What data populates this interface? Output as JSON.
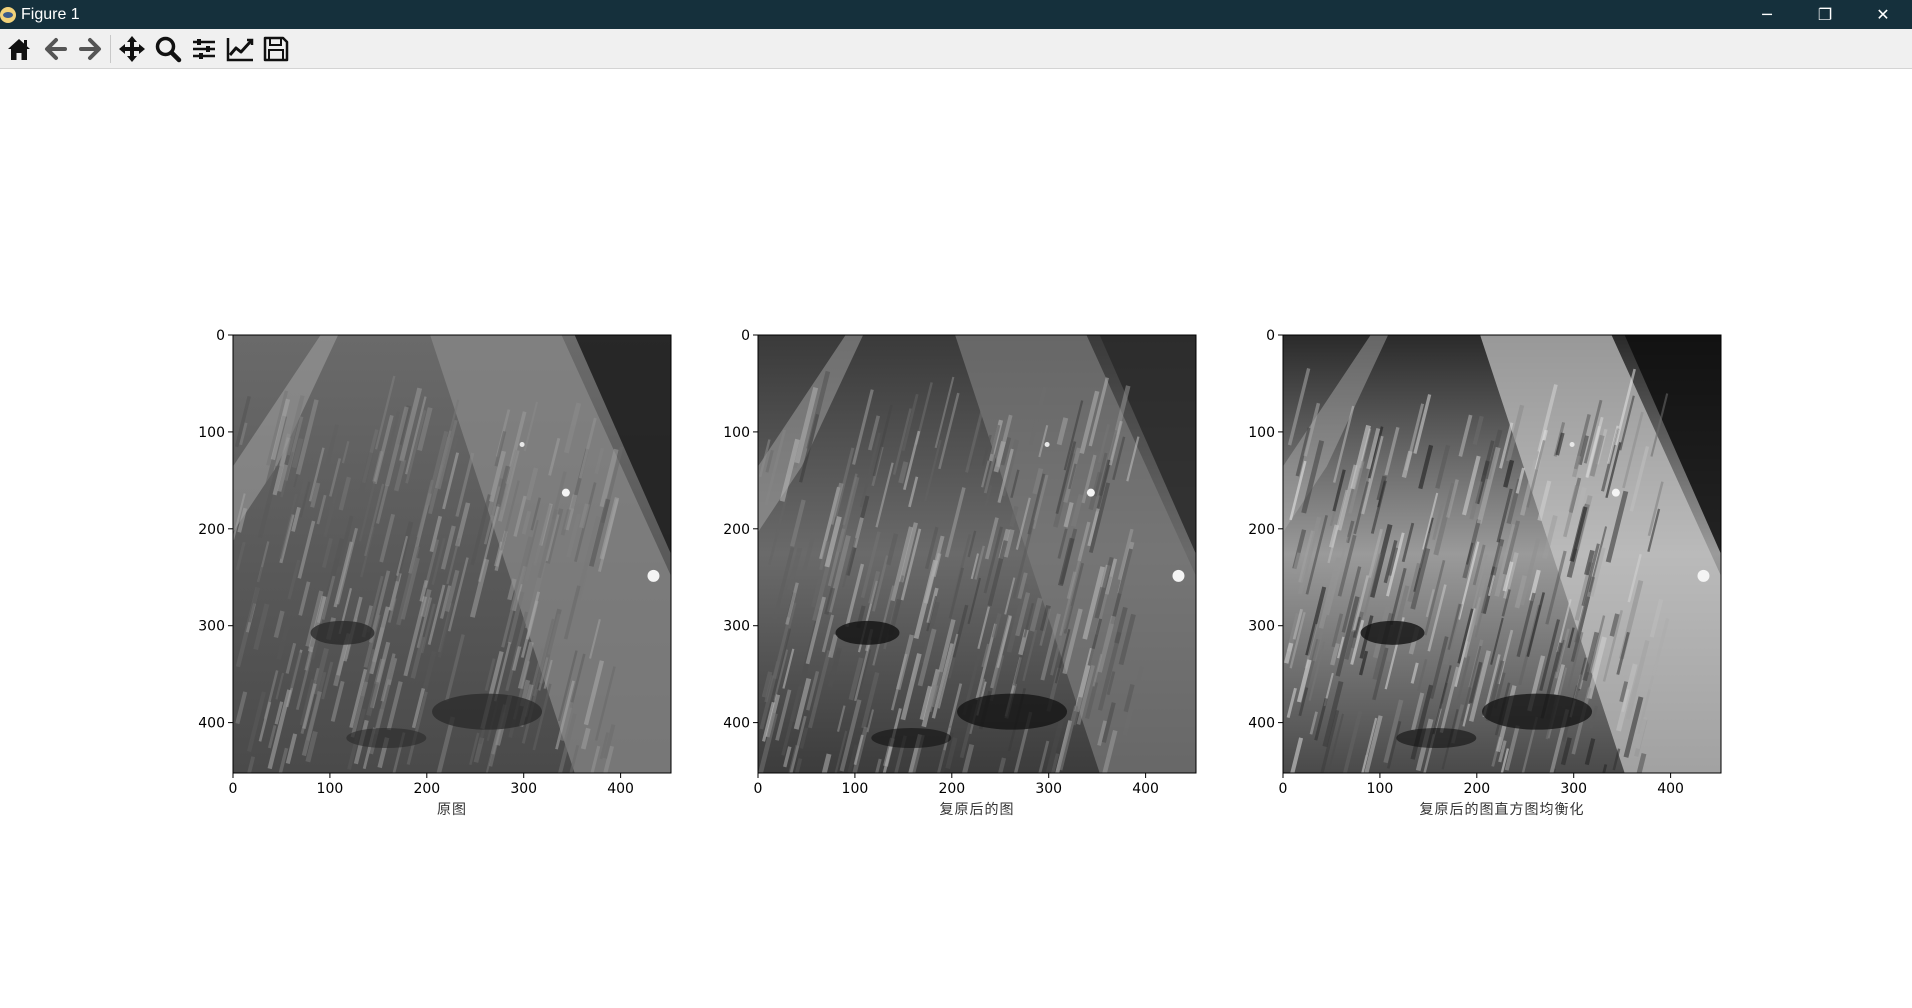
{
  "window": {
    "title": "Figure 1",
    "controls": {
      "minimize": "─",
      "maximize": "❐",
      "close": "✕"
    }
  },
  "toolbar": {
    "buttons": [
      {
        "name": "home-icon",
        "tooltip": "Home"
      },
      {
        "name": "back-arrow-icon",
        "tooltip": "Back"
      },
      {
        "name": "forward-arrow-icon",
        "tooltip": "Forward"
      },
      {
        "name": "pan-move-icon",
        "tooltip": "Pan"
      },
      {
        "name": "zoom-magnifier-icon",
        "tooltip": "Zoom"
      },
      {
        "name": "subplots-sliders-icon",
        "tooltip": "Configure subplots"
      },
      {
        "name": "edit-axis-line-icon",
        "tooltip": "Edit axis"
      },
      {
        "name": "save-floppy-icon",
        "tooltip": "Save"
      }
    ]
  },
  "chart_data": [
    {
      "type": "image",
      "title": "",
      "xlabel": "原图",
      "ylabel": "",
      "xlim": [
        0,
        452
      ],
      "ylim": [
        452,
        0
      ],
      "xticks": [
        0,
        100,
        200,
        300,
        400
      ],
      "yticks": [
        0,
        100,
        200,
        300,
        400
      ],
      "xtick_labels": [
        "0",
        "100",
        "200",
        "300",
        "400"
      ],
      "ytick_labels": [
        "0",
        "100",
        "200",
        "300",
        "400"
      ],
      "colormap": "gray",
      "grid": false
    },
    {
      "type": "image",
      "title": "",
      "xlabel": "复原后的图",
      "ylabel": "",
      "xlim": [
        0,
        452
      ],
      "ylim": [
        452,
        0
      ],
      "xticks": [
        0,
        100,
        200,
        300,
        400
      ],
      "yticks": [
        0,
        100,
        200,
        300,
        400
      ],
      "xtick_labels": [
        "0",
        "100",
        "200",
        "300",
        "400"
      ],
      "ytick_labels": [
        "0",
        "100",
        "200",
        "300",
        "400"
      ],
      "colormap": "gray",
      "grid": false
    },
    {
      "type": "image",
      "title": "",
      "xlabel": "复原后的图直方图均衡化",
      "ylabel": "",
      "xlim": [
        0,
        452
      ],
      "ylim": [
        452,
        0
      ],
      "xticks": [
        0,
        100,
        200,
        300,
        400
      ],
      "yticks": [
        0,
        100,
        200,
        300,
        400
      ],
      "xtick_labels": [
        "0",
        "100",
        "200",
        "300",
        "400"
      ],
      "ytick_labels": [
        "0",
        "100",
        "200",
        "300",
        "400"
      ],
      "colormap": "gray",
      "grid": false
    }
  ]
}
